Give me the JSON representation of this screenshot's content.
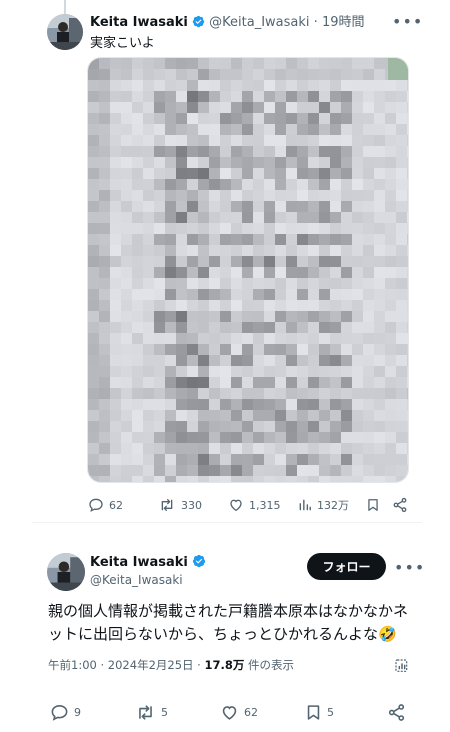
{
  "colors": {
    "text": "#0f1419",
    "muted": "#536471",
    "verified": "#1d9bf0",
    "divider": "#eff3f4",
    "follow_bg": "#0f1419"
  },
  "tweet1": {
    "author_name": "Keita Iwasaki",
    "author_handle": "@Keita_Iwasaki",
    "separator": "·",
    "time": "19時間",
    "text": "実家こいよ",
    "media": {
      "kind": "pixelated document photo"
    },
    "actions": {
      "replies": "62",
      "retweets": "330",
      "likes": "1,315",
      "views": "132万"
    },
    "icons": [
      "verified-badge-icon",
      "more-icon",
      "reply-icon",
      "retweet-icon",
      "like-icon",
      "views-icon",
      "bookmark-icon",
      "share-icon"
    ]
  },
  "tweet2": {
    "author_name": "Keita Iwasaki",
    "author_handle": "@Keita_Iwasaki",
    "follow_label": "フォロー",
    "text_line1": "親の個人情報が掲載された戸籍謄本原本はなかなかネ",
    "text_line2": "ットに出回らないから、ちょっとひかれるんよな🤣",
    "meta": {
      "time": "午前1:00",
      "separator": "·",
      "date": "2024年2月25日",
      "views_count": "17.8万",
      "views_label": " 件の表示"
    },
    "actions": {
      "replies": "9",
      "retweets": "5",
      "likes": "62",
      "bookmarks": "5"
    },
    "icons": [
      "verified-badge-icon",
      "more-icon",
      "analytics-icon",
      "reply-icon",
      "retweet-icon",
      "like-icon",
      "bookmark-icon",
      "share-icon"
    ]
  }
}
